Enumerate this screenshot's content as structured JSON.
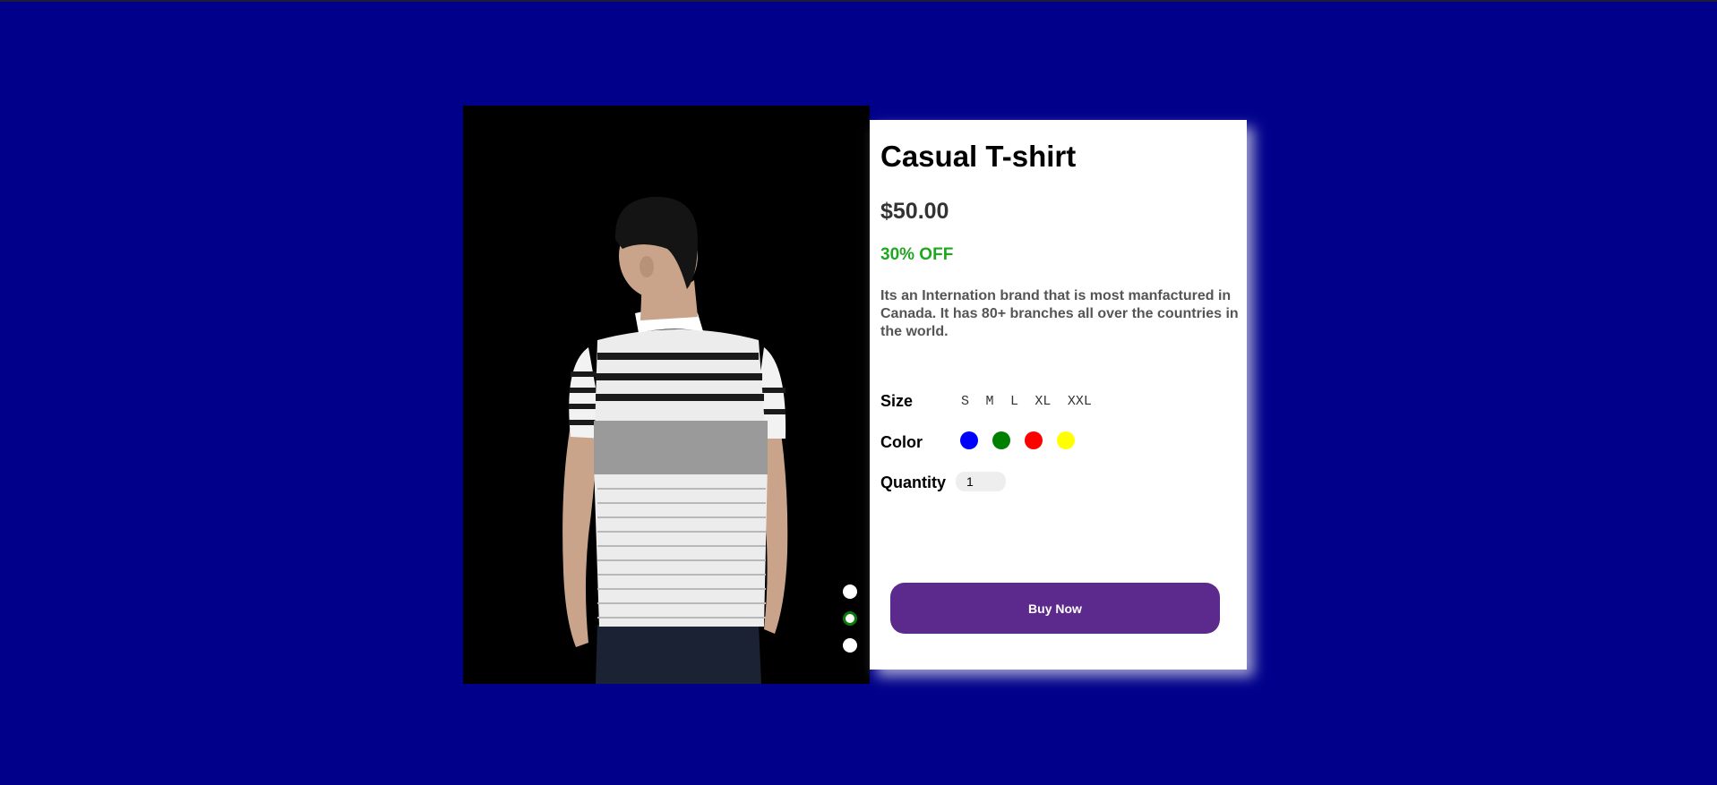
{
  "product": {
    "title": "Casual T-shirt",
    "price": "$50.00",
    "discount": "30% OFF",
    "description": "Its an Internation brand that is most manfactured in Canada. It has 80+ branches all over the countries in the world."
  },
  "options": {
    "size_label": "Size",
    "sizes": [
      "S",
      "M",
      "L",
      "XL",
      "XXL"
    ],
    "color_label": "Color",
    "colors": [
      "#0000ff",
      "#008000",
      "#ff0000",
      "#ffff00"
    ],
    "quantity_label": "Quantity",
    "quantity_value": "1"
  },
  "actions": {
    "buy_label": "Buy Now"
  },
  "carousel": {
    "slide_count": 3,
    "active_index": 1
  },
  "theme": {
    "background": "#00008b",
    "discount_color": "#1fa81f",
    "button_color": "#5b2a8c"
  }
}
